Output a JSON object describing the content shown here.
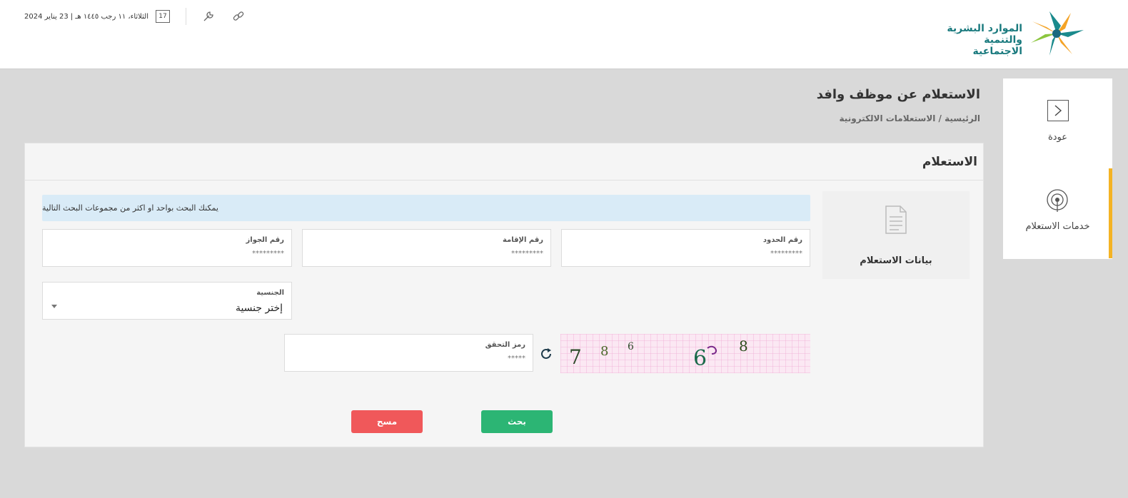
{
  "header": {
    "logo_line1": "الموارد البشرية",
    "logo_line2": "والتنمية الاجتماعية",
    "date_text": "الثلاثاء، ١١ رجب ١٤٤٥ هـ | 23 يناير 2024",
    "calendar_day": "17",
    "icons": [
      "link-icon",
      "wrench-icon",
      "calendar-icon"
    ]
  },
  "sidebar": {
    "items": [
      {
        "label": "عودة",
        "icon": "chevron-right-icon"
      },
      {
        "label": "خدمات الاستعلام",
        "icon": "broadcast-icon"
      }
    ],
    "accent_color": "#f4b324"
  },
  "page": {
    "title": "الاستعلام عن موظف وافد",
    "breadcrumb": "الرئيسية / الاستعلامات الالكترونية"
  },
  "panel": {
    "title": "الاستعلام",
    "data_card_label": "بيانات الاستعلام",
    "info_text": "يمكنك البحث بواحد او اكثر من مجموعات البحث التالية",
    "fields": {
      "border_number": {
        "label": "رقم الحدود",
        "placeholder": "*********"
      },
      "iqama_number": {
        "label": "رقم الإقامة",
        "placeholder": "*********"
      },
      "passport_number": {
        "label": "رقم الجواز",
        "placeholder": "*********"
      },
      "nationality": {
        "label": "الجنسية",
        "value": "إختر جنسية"
      },
      "captcha_code": {
        "label": "رمز التحقق",
        "placeholder": "*****"
      }
    },
    "captcha_digits": [
      "7",
      "8",
      "6",
      "6",
      "8"
    ],
    "buttons": {
      "search": "بحث",
      "clear": "مسح"
    },
    "colors": {
      "search_button": "#2cb574",
      "clear_button": "#f0585a",
      "info_bar": "#d9ebf7"
    }
  }
}
